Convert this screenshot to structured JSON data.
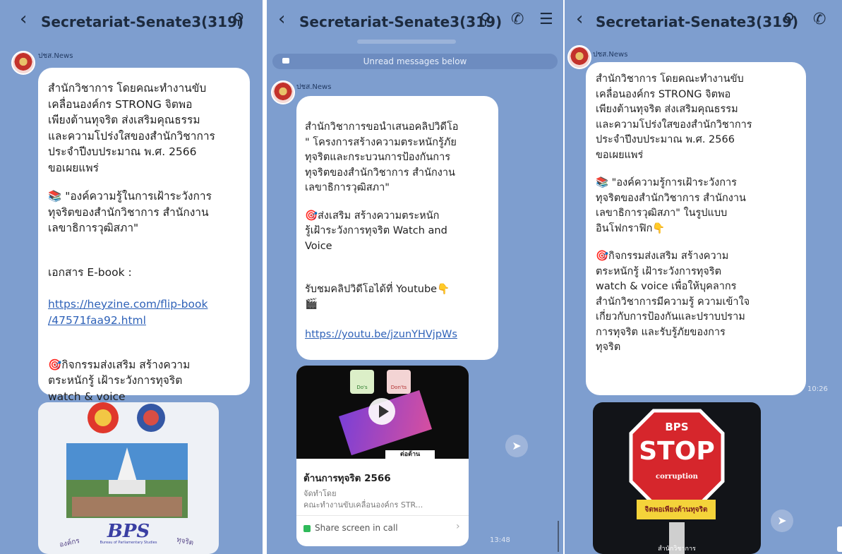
{
  "chat": {
    "title": "Secretariat-Senate3(319)",
    "sender": "ปชส.News"
  },
  "panel1": {
    "message": {
      "para1": "สำนักวิชาการ โดยคณะทำงานขับ\nเคลื่อนองค์กร STRONG จิตพอ\nเพียงต้านทุจริต ส่งเสริมคุณธรรม\nและความโปร่งใสของสำนักวิชาการ\nประจำปีงบประมาณ พ.ศ. 2566\nขอเผยแพร่",
      "para2": "📚 \"องค์ความรู้ในการเฝ้าระวังการ\nทุจริตของสำนักวิชาการ สำนักงาน\nเลขาธิการวุฒิสภา\"",
      "para3_label": "เอกสาร E-book :",
      "para3_link": "https://heyzine.com/flip-book\n/47571faa92.html",
      "para4": "🎯กิจกรรมส่งเสริม สร้างความ\nตระหนักรู้ เฝ้าระวังการทุจริต\nwatch & voice"
    },
    "poster": {
      "logo_text": "BPS",
      "logo_sub": "Bureau of Parliamentary Studies",
      "arc_left": "องค์กร",
      "arc_right": "ทุจริต"
    }
  },
  "panel2": {
    "unread_label": "Unread messages below",
    "message": {
      "para1": "สำนักวิชาการขอนำเสนอคลิปวิดีโอ\n\" โครงการสร้างความตระหนักรู้ภัย\nทุจริตและกระบวนการป้องกันการ\nทุจริตของสำนักวิชาการ สำนักงาน\nเลขาธิการวุฒิสภา\"",
      "para2": "🎯ส่งเสริม สร้างความตระหนัก\nรู้เฝ้าระวังการทุจริต Watch and\nVoice",
      "para3": "รับชมคลิปวิดีโอได้ที่ Youtube👇\n🎬",
      "link": "https://youtu.be/jzunYHVjpWs"
    },
    "video": {
      "do_label": "Do's",
      "dont_label": "Don'ts",
      "thumb_text": "ต่อต้าน",
      "title": "ต้านการทุจริต 2566",
      "sub1": "จัดทำโดย",
      "sub2": "คณะทำงานขับเคลื่อนองค์กร STR...",
      "share_label": "Share screen in call",
      "time": "13:48"
    }
  },
  "panel3": {
    "message": {
      "para1": "สำนักวิชาการ โดยคณะทำงานขับ\nเคลื่อนองค์กร STRONG จิตพอ\nเพียงต้านทุจริต ส่งเสริมคุณธรรม\nและความโปร่งใสของสำนักวิชาการ\nประจำปีงบประมาณ พ.ศ. 2566\nขอเผยแพร่",
      "para2": "📚 \"องค์ความรู้การเฝ้าระวังการ\nทุจริตของสำนักวิชาการ สำนักงาน\nเลขาธิการวุฒิสภา\" ในรูปแบบ\nอินโฟกราฟิก👇",
      "para3": "🎯กิจกรรมส่งเสริม สร้างความ\nตระหนักรู้ เฝ้าระวังการทุจริต\nwatch & voice เพื่อให้บุคลากร\nสำนักวิชาการมีความรู้ ความเข้าใจ\nเกี่ยวกับการป้องกันและปราบปราม\nการทุจริต และรับรู้ภัยของการ\nทุจริต"
    },
    "time": "10:26",
    "poster": {
      "bps": "BPS",
      "stop": "STOP",
      "corruption": "corruption",
      "banner": "จิตพอเพียงต้านทุจริต",
      "footer": "สำนักวิชาการ"
    }
  },
  "colors": {
    "chat_bg": "#7e9ecf",
    "bubble": "#ffffff",
    "link": "#2f62b8"
  },
  "icons": [
    "chevron-left-icon",
    "search-icon",
    "phone-icon",
    "menu-icon",
    "share-icon",
    "play-icon"
  ]
}
